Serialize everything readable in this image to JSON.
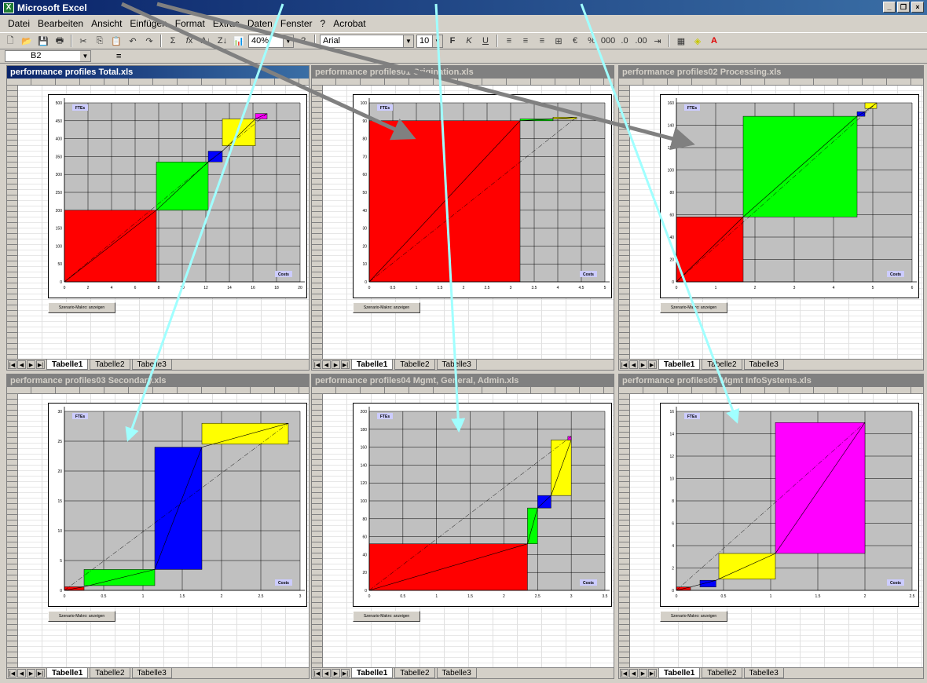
{
  "app": {
    "title": "Microsoft Excel"
  },
  "menu": [
    "Datei",
    "Bearbeiten",
    "Ansicht",
    "Einfügen",
    "Format",
    "Extras",
    "Daten",
    "Fenster",
    "?",
    "Acrobat"
  ],
  "toolbar": {
    "zoom": "40%",
    "font": "Arial",
    "size": "10"
  },
  "formula": {
    "cell": "B2",
    "eq": "="
  },
  "tabs": [
    "Tabelle1",
    "Tabelle2",
    "Tabelle3"
  ],
  "macro_label": "Szenario-Makro: anzeigen",
  "axis_y_label": "FTEs",
  "axis_x_label": "Costs",
  "workbooks": [
    {
      "title": "performance profiles Total.xls"
    },
    {
      "title": "performance profiles01 Origination.xls"
    },
    {
      "title": "performance profiles02 Processing.xls"
    },
    {
      "title": "performance profiles03 Secondary.xls"
    },
    {
      "title": "performance profiles04 Mgmt, General, Admin.xls"
    },
    {
      "title": "performance profiles05 Mgmt InfoSystems.xls"
    }
  ],
  "colors": {
    "red": "#ff0000",
    "green": "#00ff00",
    "blue": "#0000ff",
    "yellow": "#ffff00",
    "magenta": "#ff00ff",
    "plot": "#c0c0c0"
  },
  "chart_data": [
    {
      "type": "area",
      "xlim": [
        0,
        20
      ],
      "ylim": [
        0,
        500
      ],
      "x_ticks": [
        "0",
        "2",
        "4",
        "6",
        "8",
        "10",
        "12",
        "14",
        "16",
        "18",
        "20"
      ],
      "y_ticks": [
        "0",
        "50",
        "100",
        "150",
        "200",
        "250",
        "300",
        "350",
        "400",
        "450",
        "500"
      ],
      "series": [
        {
          "color": "red",
          "x0": 0,
          "x1": 7.8,
          "y0": 0,
          "y1": 200
        },
        {
          "color": "green",
          "x0": 7.8,
          "x1": 12.2,
          "y0": 200,
          "y1": 335
        },
        {
          "color": "blue",
          "x0": 12.2,
          "x1": 13.4,
          "y0": 335,
          "y1": 365
        },
        {
          "color": "yellow",
          "x0": 13.4,
          "x1": 16.2,
          "y0": 380,
          "y1": 455
        },
        {
          "color": "magenta",
          "x0": 16.2,
          "x1": 17.2,
          "y0": 455,
          "y1": 470
        }
      ]
    },
    {
      "type": "area",
      "xlim": [
        0,
        5
      ],
      "ylim": [
        0,
        100
      ],
      "x_ticks": [
        "0",
        "0.5",
        "1",
        "1.5",
        "2",
        "2.5",
        "3",
        "3.5",
        "4",
        "4.5",
        "5"
      ],
      "y_ticks": [
        "0",
        "10",
        "20",
        "30",
        "40",
        "50",
        "60",
        "70",
        "80",
        "90",
        "100"
      ],
      "series": [
        {
          "color": "red",
          "x0": 0,
          "x1": 3.2,
          "y0": 0,
          "y1": 90
        },
        {
          "color": "green",
          "x0": 3.2,
          "x1": 3.9,
          "y0": 90,
          "y1": 91
        },
        {
          "color": "yellow",
          "x0": 3.9,
          "x1": 4.4,
          "y0": 91,
          "y1": 92
        }
      ]
    },
    {
      "type": "area",
      "xlim": [
        0,
        6
      ],
      "ylim": [
        0,
        160
      ],
      "x_ticks": [
        "0",
        "1",
        "2",
        "3",
        "4",
        "5",
        "6"
      ],
      "y_ticks": [
        "0",
        "20",
        "40",
        "60",
        "80",
        "100",
        "120",
        "140",
        "160"
      ],
      "series": [
        {
          "color": "red",
          "x0": 0,
          "x1": 1.7,
          "y0": 0,
          "y1": 58
        },
        {
          "color": "green",
          "x0": 1.7,
          "x1": 4.6,
          "y0": 58,
          "y1": 148
        },
        {
          "color": "blue",
          "x0": 4.6,
          "x1": 4.8,
          "y0": 148,
          "y1": 152
        },
        {
          "color": "yellow",
          "x0": 4.8,
          "x1": 5.1,
          "y0": 155,
          "y1": 160
        }
      ]
    },
    {
      "type": "area",
      "xlim": [
        0,
        3
      ],
      "ylim": [
        0,
        30
      ],
      "x_ticks": [
        "0",
        "0.5",
        "1",
        "1.5",
        "2",
        "2.5",
        "3"
      ],
      "y_ticks": [
        "0",
        "5",
        "10",
        "15",
        "20",
        "25",
        "30"
      ],
      "series": [
        {
          "color": "red",
          "x0": 0,
          "x1": 0.25,
          "y0": 0,
          "y1": 0.6
        },
        {
          "color": "green",
          "x0": 0.25,
          "x1": 1.15,
          "y0": 0.8,
          "y1": 3.5
        },
        {
          "color": "blue",
          "x0": 1.15,
          "x1": 1.75,
          "y0": 3.5,
          "y1": 24
        },
        {
          "color": "yellow",
          "x0": 1.75,
          "x1": 2.85,
          "y0": 24.5,
          "y1": 28
        }
      ]
    },
    {
      "type": "area",
      "xlim": [
        0,
        3.5
      ],
      "ylim": [
        0,
        200
      ],
      "x_ticks": [
        "0",
        "0.5",
        "1",
        "1.5",
        "2",
        "2.5",
        "3",
        "3.5"
      ],
      "y_ticks": [
        "0",
        "20",
        "40",
        "60",
        "80",
        "100",
        "120",
        "140",
        "160",
        "180",
        "200"
      ],
      "series": [
        {
          "color": "red",
          "x0": 0,
          "x1": 2.35,
          "y0": 0,
          "y1": 52
        },
        {
          "color": "green",
          "x0": 2.35,
          "x1": 2.5,
          "y0": 52,
          "y1": 92
        },
        {
          "color": "blue",
          "x0": 2.5,
          "x1": 2.7,
          "y0": 92,
          "y1": 106
        },
        {
          "color": "yellow",
          "x0": 2.7,
          "x1": 3.0,
          "y0": 106,
          "y1": 168
        },
        {
          "color": "magenta",
          "x0": 2.95,
          "x1": 3.0,
          "y0": 168,
          "y1": 172
        }
      ]
    },
    {
      "type": "area",
      "xlim": [
        0,
        2.5
      ],
      "ylim": [
        0,
        16
      ],
      "x_ticks": [
        "0",
        "0.5",
        "1",
        "1.5",
        "2",
        "2.5"
      ],
      "y_ticks": [
        "0",
        "2",
        "4",
        "6",
        "8",
        "10",
        "12",
        "14",
        "16"
      ],
      "series": [
        {
          "color": "red",
          "x0": 0,
          "x1": 0.15,
          "y0": 0,
          "y1": 0.3
        },
        {
          "color": "blue",
          "x0": 0.25,
          "x1": 0.42,
          "y0": 0.3,
          "y1": 0.9
        },
        {
          "color": "yellow",
          "x0": 0.45,
          "x1": 1.05,
          "y0": 1,
          "y1": 3.3
        },
        {
          "color": "magenta",
          "x0": 1.05,
          "x1": 2.0,
          "y0": 3.3,
          "y1": 15
        }
      ]
    }
  ]
}
